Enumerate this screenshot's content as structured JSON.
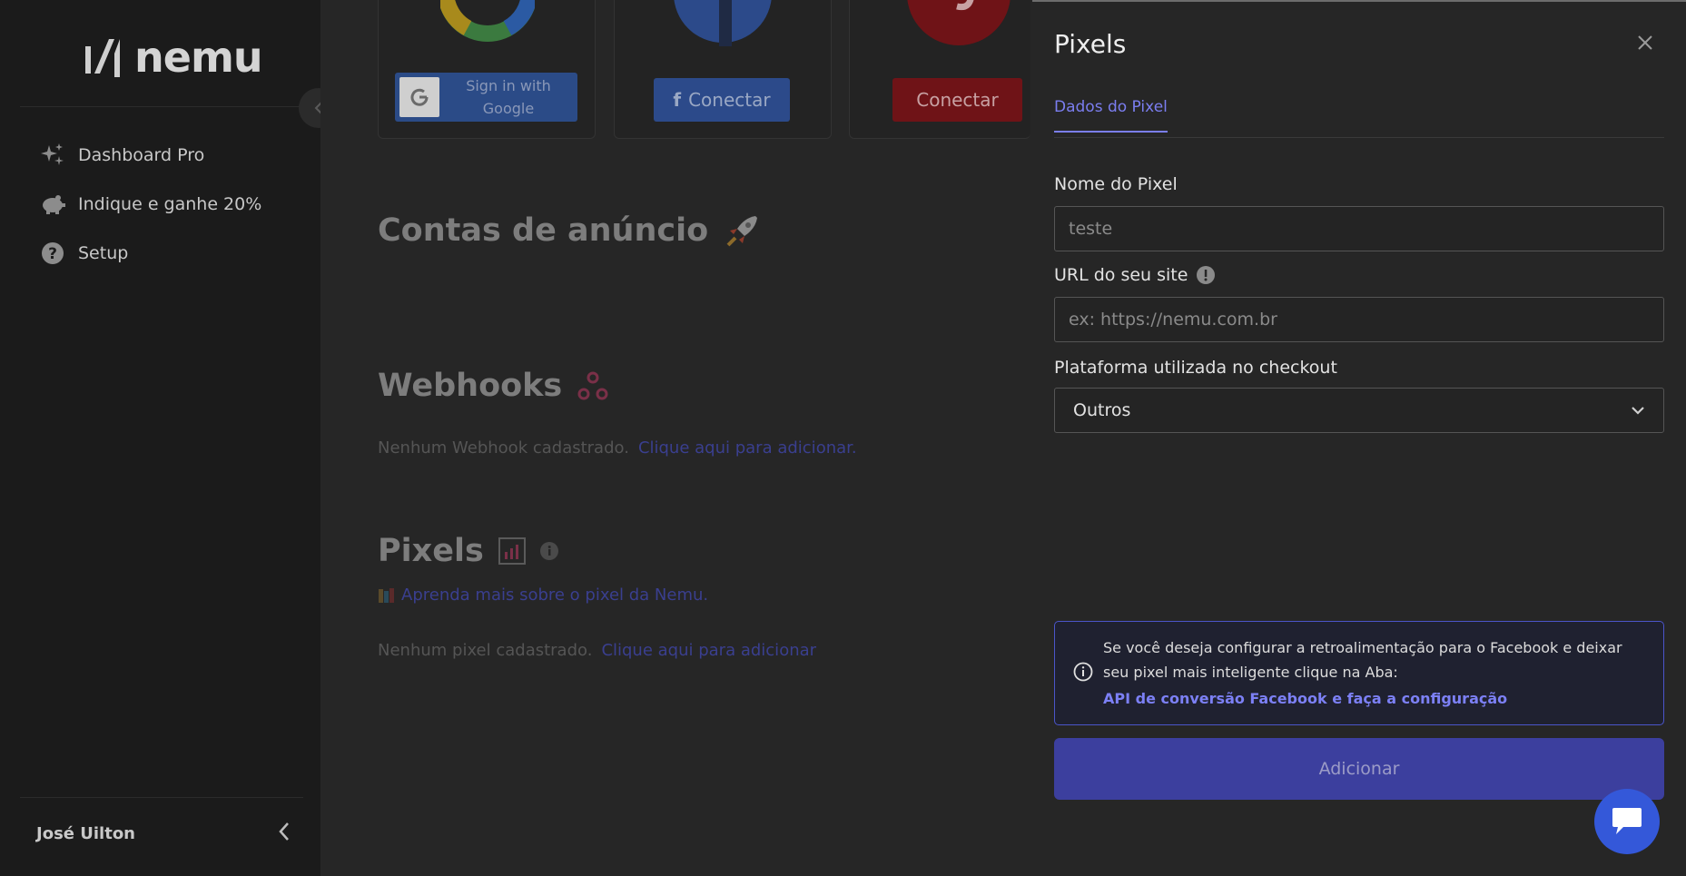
{
  "sidebar": {
    "brand": "nemu",
    "items": [
      {
        "label": "Dashboard Pro",
        "icon": "sparkles-icon"
      },
      {
        "label": "Indique e ganhe 20%",
        "icon": "piggy-bank-icon"
      },
      {
        "label": "Setup",
        "icon": "question-circle-icon"
      }
    ],
    "user_name": "José Uilton"
  },
  "main": {
    "integrations": {
      "google_button": "Sign in with Google",
      "facebook_button": "Conectar",
      "pinterest_button": "Conectar"
    },
    "ad_accounts_title": "Contas de anúncio",
    "webhooks": {
      "title": "Webhooks",
      "empty_text": "Nenhum Webhook cadastrado.",
      "add_link": "Clique aqui para adicionar."
    },
    "pixels": {
      "title": "Pixels",
      "learn_link": "Aprenda mais sobre o pixel da Nemu.",
      "empty_text": "Nenhum pixel cadastrado.",
      "add_link": "Clique aqui para adicionar"
    }
  },
  "panel": {
    "title": "Pixels",
    "tab": "Dados do Pixel",
    "pixel_name_label": "Nome do Pixel",
    "pixel_name_value": "teste",
    "url_label": "URL do seu site",
    "url_placeholder": "ex: https://nemu.com.br",
    "platform_label": "Plataforma utilizada no checkout",
    "platform_selected": "Outros",
    "alert_text": "Se você deseja configurar a retroalimentação para o Facebook e deixar seu pixel mais inteligente clique na Aba:",
    "alert_link": "API de conversão Facebook e faça a configuração",
    "add_button": "Adicionar"
  },
  "colors": {
    "accent": "#7b7ef0",
    "button": "#3c3f9e",
    "chat": "#3458d9"
  }
}
